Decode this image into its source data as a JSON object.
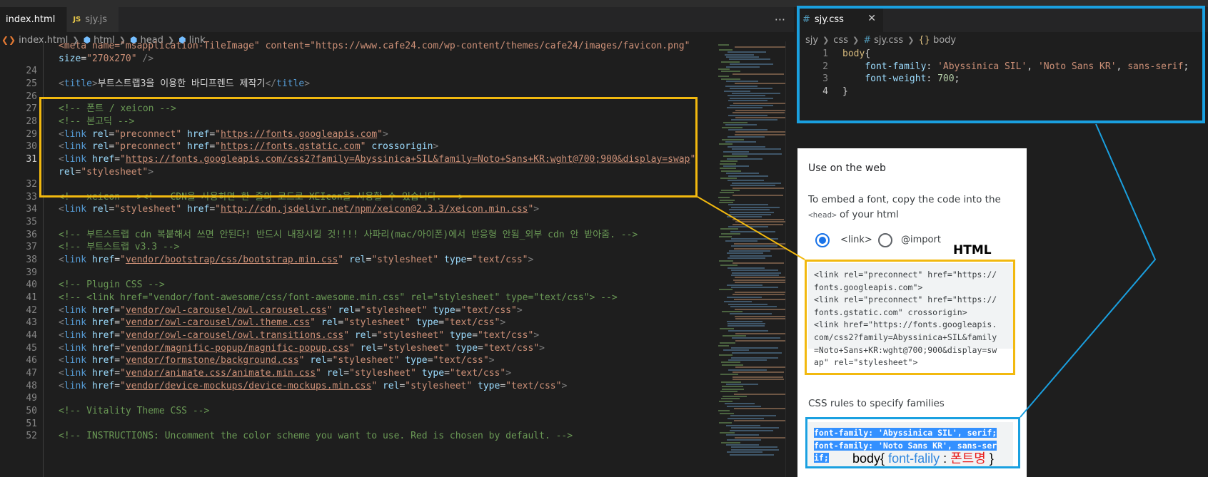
{
  "left_editor": {
    "tabs": [
      {
        "label": "index.html",
        "active": true
      },
      {
        "label": "sjy.js",
        "active": false,
        "badge": "JS"
      }
    ],
    "tab_more": "···",
    "breadcrumb": [
      "index.html",
      "html",
      "head",
      "link"
    ],
    "lines": [
      {
        "n": "",
        "parts": [
          [
            "str",
            "<meta name=\"msapplication-TileImage\" content=\"https://www.cafe24.com/wp-content/themes/cafe24/images/favicon.png\""
          ]
        ]
      },
      {
        "n": "",
        "parts": [
          [
            "attr",
            "size"
          ],
          [
            "txt",
            "="
          ],
          [
            "str",
            "\"270x270\""
          ],
          [
            "br",
            " />"
          ]
        ]
      },
      {
        "n": "24",
        "parts": []
      },
      {
        "n": "25",
        "parts": [
          [
            "br",
            "<"
          ],
          [
            "tag",
            "title"
          ],
          [
            "br",
            ">"
          ],
          [
            "txt",
            "부트스트랩3을 이용한 바디프렌드 제작기"
          ],
          [
            "br",
            "</"
          ],
          [
            "tag",
            "title"
          ],
          [
            "br",
            ">"
          ]
        ]
      },
      {
        "n": "26",
        "parts": []
      },
      {
        "n": "27",
        "parts": [
          [
            "cmt",
            "<!-- 폰트 / xeicon -->"
          ]
        ]
      },
      {
        "n": "28",
        "parts": [
          [
            "cmt",
            "<!-- 본고딕 -->"
          ]
        ]
      },
      {
        "n": "29",
        "parts": [
          [
            "br",
            "<"
          ],
          [
            "tag",
            "link"
          ],
          [
            "txt",
            " "
          ],
          [
            "attr",
            "rel"
          ],
          [
            "txt",
            "="
          ],
          [
            "str",
            "\"preconnect\""
          ],
          [
            "txt",
            " "
          ],
          [
            "attr",
            "href"
          ],
          [
            "txt",
            "="
          ],
          [
            "str",
            "\""
          ],
          [
            "url",
            "https://fonts.googleapis.com"
          ],
          [
            "str",
            "\""
          ],
          [
            "br",
            ">"
          ]
        ]
      },
      {
        "n": "30",
        "parts": [
          [
            "br",
            "<"
          ],
          [
            "tag",
            "link"
          ],
          [
            "txt",
            " "
          ],
          [
            "attr",
            "rel"
          ],
          [
            "txt",
            "="
          ],
          [
            "str",
            "\"preconnect\""
          ],
          [
            "txt",
            " "
          ],
          [
            "attr",
            "href"
          ],
          [
            "txt",
            "="
          ],
          [
            "str",
            "\""
          ],
          [
            "url",
            "https://fonts.gstatic.com"
          ],
          [
            "str",
            "\""
          ],
          [
            "txt",
            " "
          ],
          [
            "attr",
            "crossorigin"
          ],
          [
            "br",
            ">"
          ]
        ]
      },
      {
        "n": "31",
        "parts": [
          [
            "br",
            "<"
          ],
          [
            "tag",
            "link"
          ],
          [
            "txt",
            " "
          ],
          [
            "attr",
            "href"
          ],
          [
            "txt",
            "="
          ],
          [
            "str",
            "\""
          ],
          [
            "url",
            "https://fonts.googleapis.com/css2?family=Abyssinica+SIL&family=Noto+Sans+KR:wght@700;900&display=swap"
          ],
          [
            "str",
            "\""
          ]
        ]
      },
      {
        "n": "",
        "parts": [
          [
            "attr",
            "rel"
          ],
          [
            "txt",
            "="
          ],
          [
            "str",
            "\"stylesheet\""
          ],
          [
            "br",
            ">"
          ]
        ]
      },
      {
        "n": "32",
        "parts": []
      },
      {
        "n": "33",
        "parts": [
          [
            "cmt",
            "<!-- xeicon --><!-- CDN을 사용하면 한 줄의 코드로 XEIcon을 사용할 수 있습니다. -->"
          ]
        ]
      },
      {
        "n": "34",
        "parts": [
          [
            "br",
            "<"
          ],
          [
            "tag",
            "link"
          ],
          [
            "txt",
            " "
          ],
          [
            "attr",
            "rel"
          ],
          [
            "txt",
            "="
          ],
          [
            "str",
            "\"stylesheet\""
          ],
          [
            "txt",
            " "
          ],
          [
            "attr",
            "href"
          ],
          [
            "txt",
            "="
          ],
          [
            "str",
            "\""
          ],
          [
            "url",
            "http://cdn.jsdelivr.net/npm/xeicon@2.3.3/xeicon.min.css"
          ],
          [
            "str",
            "\""
          ],
          [
            "br",
            ">"
          ]
        ]
      },
      {
        "n": "35",
        "parts": []
      },
      {
        "n": "36",
        "parts": [
          [
            "cmt",
            "<!-- 부트스트랩 cdn 복붙해서 쓰면 안된다! 반드시 내장시킬 것!!!! 사파리(mac/아이폰)에서 반응형 안됨_외부 cdn 안 받아줌. -->"
          ]
        ]
      },
      {
        "n": "37",
        "parts": [
          [
            "cmt",
            "<!-- 부트스트랩 v3.3 -->"
          ]
        ]
      },
      {
        "n": "38",
        "parts": [
          [
            "br",
            "<"
          ],
          [
            "tag",
            "link"
          ],
          [
            "txt",
            " "
          ],
          [
            "attr",
            "href"
          ],
          [
            "txt",
            "="
          ],
          [
            "str",
            "\""
          ],
          [
            "url",
            "vendor/bootstrap/css/bootstrap.min.css"
          ],
          [
            "str",
            "\""
          ],
          [
            "txt",
            " "
          ],
          [
            "attr",
            "rel"
          ],
          [
            "txt",
            "="
          ],
          [
            "str",
            "\"stylesheet\""
          ],
          [
            "txt",
            " "
          ],
          [
            "attr",
            "type"
          ],
          [
            "txt",
            "="
          ],
          [
            "str",
            "\"text/css\""
          ],
          [
            "br",
            ">"
          ]
        ]
      },
      {
        "n": "39",
        "parts": []
      },
      {
        "n": "40",
        "parts": [
          [
            "cmt",
            "<!-- Plugin CSS -->"
          ]
        ]
      },
      {
        "n": "41",
        "parts": [
          [
            "cmt",
            "<!-- <link href=\"vendor/font-awesome/css/font-awesome.min.css\" rel=\"stylesheet\" type=\"text/css\"> -->"
          ]
        ]
      },
      {
        "n": "42",
        "parts": [
          [
            "br",
            "<"
          ],
          [
            "tag",
            "link"
          ],
          [
            "txt",
            " "
          ],
          [
            "attr",
            "href"
          ],
          [
            "txt",
            "="
          ],
          [
            "str",
            "\""
          ],
          [
            "url",
            "vendor/owl-carousel/owl.carousel.css"
          ],
          [
            "str",
            "\""
          ],
          [
            "txt",
            " "
          ],
          [
            "attr",
            "rel"
          ],
          [
            "txt",
            "="
          ],
          [
            "str",
            "\"stylesheet\""
          ],
          [
            "txt",
            " "
          ],
          [
            "attr",
            "type"
          ],
          [
            "txt",
            "="
          ],
          [
            "str",
            "\"text/css\""
          ],
          [
            "br",
            ">"
          ]
        ]
      },
      {
        "n": "43",
        "parts": [
          [
            "br",
            "<"
          ],
          [
            "tag",
            "link"
          ],
          [
            "txt",
            " "
          ],
          [
            "attr",
            "href"
          ],
          [
            "txt",
            "="
          ],
          [
            "str",
            "\""
          ],
          [
            "url",
            "vendor/owl-carousel/owl.theme.css"
          ],
          [
            "str",
            "\""
          ],
          [
            "txt",
            " "
          ],
          [
            "attr",
            "rel"
          ],
          [
            "txt",
            "="
          ],
          [
            "str",
            "\"stylesheet\""
          ],
          [
            "txt",
            " "
          ],
          [
            "attr",
            "type"
          ],
          [
            "txt",
            "="
          ],
          [
            "str",
            "\"text/css\""
          ],
          [
            "br",
            ">"
          ]
        ]
      },
      {
        "n": "44",
        "parts": [
          [
            "br",
            "<"
          ],
          [
            "tag",
            "link"
          ],
          [
            "txt",
            " "
          ],
          [
            "attr",
            "href"
          ],
          [
            "txt",
            "="
          ],
          [
            "str",
            "\""
          ],
          [
            "url",
            "vendor/owl-carousel/owl.transitions.css"
          ],
          [
            "str",
            "\""
          ],
          [
            "txt",
            " "
          ],
          [
            "attr",
            "rel"
          ],
          [
            "txt",
            "="
          ],
          [
            "str",
            "\"stylesheet\""
          ],
          [
            "txt",
            " "
          ],
          [
            "attr",
            "type"
          ],
          [
            "txt",
            "="
          ],
          [
            "str",
            "\"text/css\""
          ],
          [
            "br",
            ">"
          ]
        ]
      },
      {
        "n": "45",
        "parts": [
          [
            "br",
            "<"
          ],
          [
            "tag",
            "link"
          ],
          [
            "txt",
            " "
          ],
          [
            "attr",
            "href"
          ],
          [
            "txt",
            "="
          ],
          [
            "str",
            "\""
          ],
          [
            "url",
            "vendor/magnific-popup/magnific-popup.css"
          ],
          [
            "str",
            "\""
          ],
          [
            "txt",
            " "
          ],
          [
            "attr",
            "rel"
          ],
          [
            "txt",
            "="
          ],
          [
            "str",
            "\"stylesheet\""
          ],
          [
            "txt",
            " "
          ],
          [
            "attr",
            "type"
          ],
          [
            "txt",
            "="
          ],
          [
            "str",
            "\"text/css\""
          ],
          [
            "br",
            ">"
          ]
        ]
      },
      {
        "n": "46",
        "parts": [
          [
            "br",
            "<"
          ],
          [
            "tag",
            "link"
          ],
          [
            "txt",
            " "
          ],
          [
            "attr",
            "href"
          ],
          [
            "txt",
            "="
          ],
          [
            "str",
            "\""
          ],
          [
            "url",
            "vendor/formstone/background.css"
          ],
          [
            "str",
            "\""
          ],
          [
            "txt",
            " "
          ],
          [
            "attr",
            "rel"
          ],
          [
            "txt",
            "="
          ],
          [
            "str",
            "\"stylesheet\""
          ],
          [
            "txt",
            " "
          ],
          [
            "attr",
            "type"
          ],
          [
            "txt",
            "="
          ],
          [
            "str",
            "\"text/css\""
          ],
          [
            "br",
            ">"
          ]
        ]
      },
      {
        "n": "47",
        "parts": [
          [
            "br",
            "<"
          ],
          [
            "tag",
            "link"
          ],
          [
            "txt",
            " "
          ],
          [
            "attr",
            "href"
          ],
          [
            "txt",
            "="
          ],
          [
            "str",
            "\""
          ],
          [
            "url",
            "vendor/animate.css/animate.min.css"
          ],
          [
            "str",
            "\""
          ],
          [
            "txt",
            " "
          ],
          [
            "attr",
            "rel"
          ],
          [
            "txt",
            "="
          ],
          [
            "str",
            "\"stylesheet\""
          ],
          [
            "txt",
            " "
          ],
          [
            "attr",
            "type"
          ],
          [
            "txt",
            "="
          ],
          [
            "str",
            "\"text/css\""
          ],
          [
            "br",
            ">"
          ]
        ]
      },
      {
        "n": "48",
        "parts": [
          [
            "br",
            "<"
          ],
          [
            "tag",
            "link"
          ],
          [
            "txt",
            " "
          ],
          [
            "attr",
            "href"
          ],
          [
            "txt",
            "="
          ],
          [
            "str",
            "\""
          ],
          [
            "url",
            "vendor/device-mockups/device-mockups.min.css"
          ],
          [
            "str",
            "\""
          ],
          [
            "txt",
            " "
          ],
          [
            "attr",
            "rel"
          ],
          [
            "txt",
            "="
          ],
          [
            "str",
            "\"stylesheet\""
          ],
          [
            "txt",
            " "
          ],
          [
            "attr",
            "type"
          ],
          [
            "txt",
            "="
          ],
          [
            "str",
            "\"text/css\""
          ],
          [
            "br",
            ">"
          ]
        ]
      },
      {
        "n": "49",
        "parts": []
      },
      {
        "n": "50",
        "parts": [
          [
            "cmt",
            "<!-- Vitality Theme CSS -->"
          ]
        ]
      },
      {
        "n": "51",
        "parts": []
      },
      {
        "n": "52",
        "parts": [
          [
            "cmt",
            "<!-- INSTRUCTIONS: Uncomment the color scheme you want to use. Red is chosen by default. -->"
          ]
        ]
      }
    ]
  },
  "right_editor": {
    "tab_label": "sjy.css",
    "close_glyph": "✕",
    "breadcrumb": [
      "sjy",
      "css",
      "sjy.css",
      "body"
    ],
    "lines": [
      {
        "n": "1",
        "parts": [
          [
            "sel",
            "body"
          ],
          [
            "txt",
            "{"
          ]
        ]
      },
      {
        "n": "2",
        "parts": [
          [
            "txt",
            "    "
          ],
          [
            "prop",
            "font-family"
          ],
          [
            "txt",
            ": "
          ],
          [
            "str",
            "'Abyssinica SIL'"
          ],
          [
            "txt",
            ", "
          ],
          [
            "str",
            "'Noto Sans KR'"
          ],
          [
            "txt",
            ", "
          ],
          [
            "str",
            "sans-serif"
          ],
          [
            "txt",
            ";"
          ]
        ]
      },
      {
        "n": "3",
        "parts": [
          [
            "txt",
            "    "
          ],
          [
            "prop",
            "font-weight"
          ],
          [
            "txt",
            ": "
          ],
          [
            "num",
            "700"
          ],
          [
            "txt",
            ";"
          ]
        ]
      },
      {
        "n": "4",
        "parts": [
          [
            "txt",
            "}"
          ]
        ]
      }
    ]
  },
  "google_panel": {
    "title": "Use on the web",
    "desc_before": "To embed a font, copy the code into the ",
    "desc_code": "<head>",
    "desc_after": " of your html",
    "radio_link": "<link>",
    "radio_import": "@import",
    "html_label": "HTML",
    "embed_lines": [
      "<link rel=\"preconnect\" href=\"https://",
      "fonts.googleapis.com\">",
      "<link rel=\"preconnect\" href=\"https://",
      "fonts.gstatic.com\" crossorigin>",
      "<link href=\"https://fonts.googleapis.",
      "com/css2?family=Abyssinica+SIL&family",
      "=Noto+Sans+KR:wght@700;900&display=sw",
      "ap\" rel=\"stylesheet\">"
    ],
    "css_rules_title": "CSS rules to specify families",
    "css_lines": [
      "font-family: 'Abyssinica SIL', serif;",
      "font-family: 'Noto Sans KR', sans-ser",
      "if;"
    ]
  },
  "annotation": {
    "selector": "body{",
    "property": "font-falily",
    "colon": " : ",
    "value": "폰트명",
    "close": " }"
  },
  "colors": {
    "highlight_yellow": "#f2b90f",
    "highlight_blue": "#1aa0e0",
    "selection_blue": "#3390ff",
    "annotation_red": "#e81c1c"
  }
}
